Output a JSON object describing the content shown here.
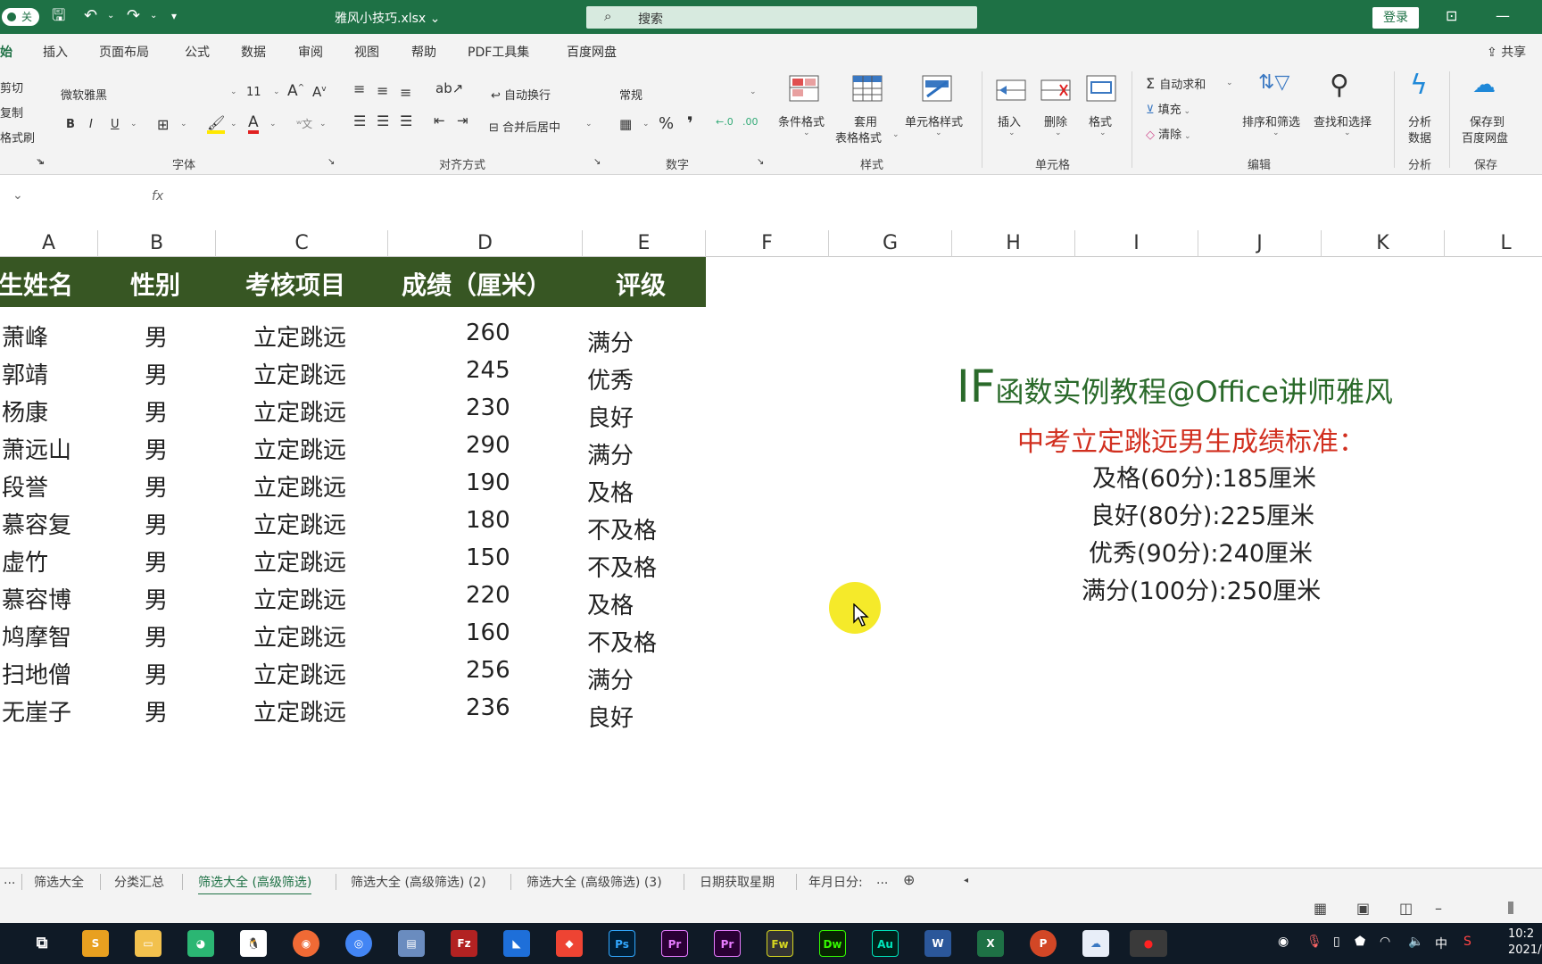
{
  "titlebar": {
    "autosave": "关",
    "doc_title": "雅风小技巧.xlsx ⌄",
    "search_placeholder": "搜索",
    "login": "登录"
  },
  "tabs": [
    "始",
    "插入",
    "页面布局",
    "公式",
    "数据",
    "审阅",
    "视图",
    "帮助",
    "PDF工具集",
    "百度网盘"
  ],
  "share": "共享",
  "ribbon": {
    "clipboard": [
      "剪切",
      "复制",
      "格式刷"
    ],
    "font_name": "微软雅黑",
    "font_size": "11",
    "bold": "B",
    "italic": "I",
    "underline": "U",
    "wrap_text": "自动换行",
    "merge_center": "合并后居中",
    "number_format": "常规",
    "percent": "%",
    "comma": "❜",
    "cond_format": "条件格式",
    "table_format_1": "套用",
    "table_format_2": "表格格式",
    "cell_style": "单元格样式",
    "insert": "插入",
    "delete": "删除",
    "format": "格式",
    "autosum": "自动求和",
    "fill": "填充",
    "clear": "清除",
    "sort_filter": "排序和筛选",
    "find_select": "查找和选择",
    "analyze_1": "分析",
    "analyze_2": "数据",
    "save_baidu_1": "保存到",
    "save_baidu_2": "百度网盘",
    "groups": {
      "font": "字体",
      "align": "对齐方式",
      "number": "数字",
      "styles": "样式",
      "cells": "单元格",
      "edit": "编辑",
      "analysis": "分析",
      "save": "保存"
    }
  },
  "columns": [
    "A",
    "B",
    "C",
    "D",
    "E",
    "F",
    "G",
    "H",
    "I",
    "J",
    "K",
    "L"
  ],
  "table": {
    "headers": [
      "生姓名",
      "性别",
      "考核项目",
      "成绩（厘米）",
      "评级"
    ],
    "rows": [
      {
        "name": "萧峰",
        "gender": "男",
        "item": "立定跳远",
        "score": "260",
        "grade": "满分"
      },
      {
        "name": "郭靖",
        "gender": "男",
        "item": "立定跳远",
        "score": "245",
        "grade": "优秀"
      },
      {
        "name": "杨康",
        "gender": "男",
        "item": "立定跳远",
        "score": "230",
        "grade": "良好"
      },
      {
        "name": "萧远山",
        "gender": "男",
        "item": "立定跳远",
        "score": "290",
        "grade": "满分"
      },
      {
        "name": "段誉",
        "gender": "男",
        "item": "立定跳远",
        "score": "190",
        "grade": "及格"
      },
      {
        "name": "慕容复",
        "gender": "男",
        "item": "立定跳远",
        "score": "180",
        "grade": "不及格"
      },
      {
        "name": "虚竹",
        "gender": "男",
        "item": "立定跳远",
        "score": "150",
        "grade": "不及格"
      },
      {
        "name": "慕容博",
        "gender": "男",
        "item": "立定跳远",
        "score": "220",
        "grade": "及格"
      },
      {
        "name": "鸠摩智",
        "gender": "男",
        "item": "立定跳远",
        "score": "160",
        "grade": "不及格"
      },
      {
        "name": "扫地僧",
        "gender": "男",
        "item": "立定跳远",
        "score": "256",
        "grade": "满分"
      },
      {
        "name": "无崖子",
        "gender": "男",
        "item": "立定跳远",
        "score": "236",
        "grade": "良好"
      }
    ]
  },
  "tutorial": {
    "title_big": "IF",
    "title_rest": "函数实例教程@Office讲师雅风",
    "standard_title": "中考立定跳远男生成绩标准：",
    "standards": [
      "及格(60分):185厘米",
      "良好(80分):225厘米",
      "优秀(90分):240厘米",
      "满分(100分):250厘米"
    ]
  },
  "sheet_tabs": [
    "...",
    "筛选大全",
    "分类汇总",
    "筛选大全 (高级筛选)",
    "筛选大全 (高级筛选) (2)",
    "筛选大全 (高级筛选) (3)",
    "日期获取星期",
    "年月日分:"
  ],
  "sheet_tabs_more": "...",
  "taskbar": {
    "clock_time": "10:2",
    "clock_date": "2021/",
    "ime": "中"
  },
  "colors": {
    "excel_green": "#1e7145",
    "header_fill": "#375623",
    "standard_red": "#d12f1f"
  }
}
